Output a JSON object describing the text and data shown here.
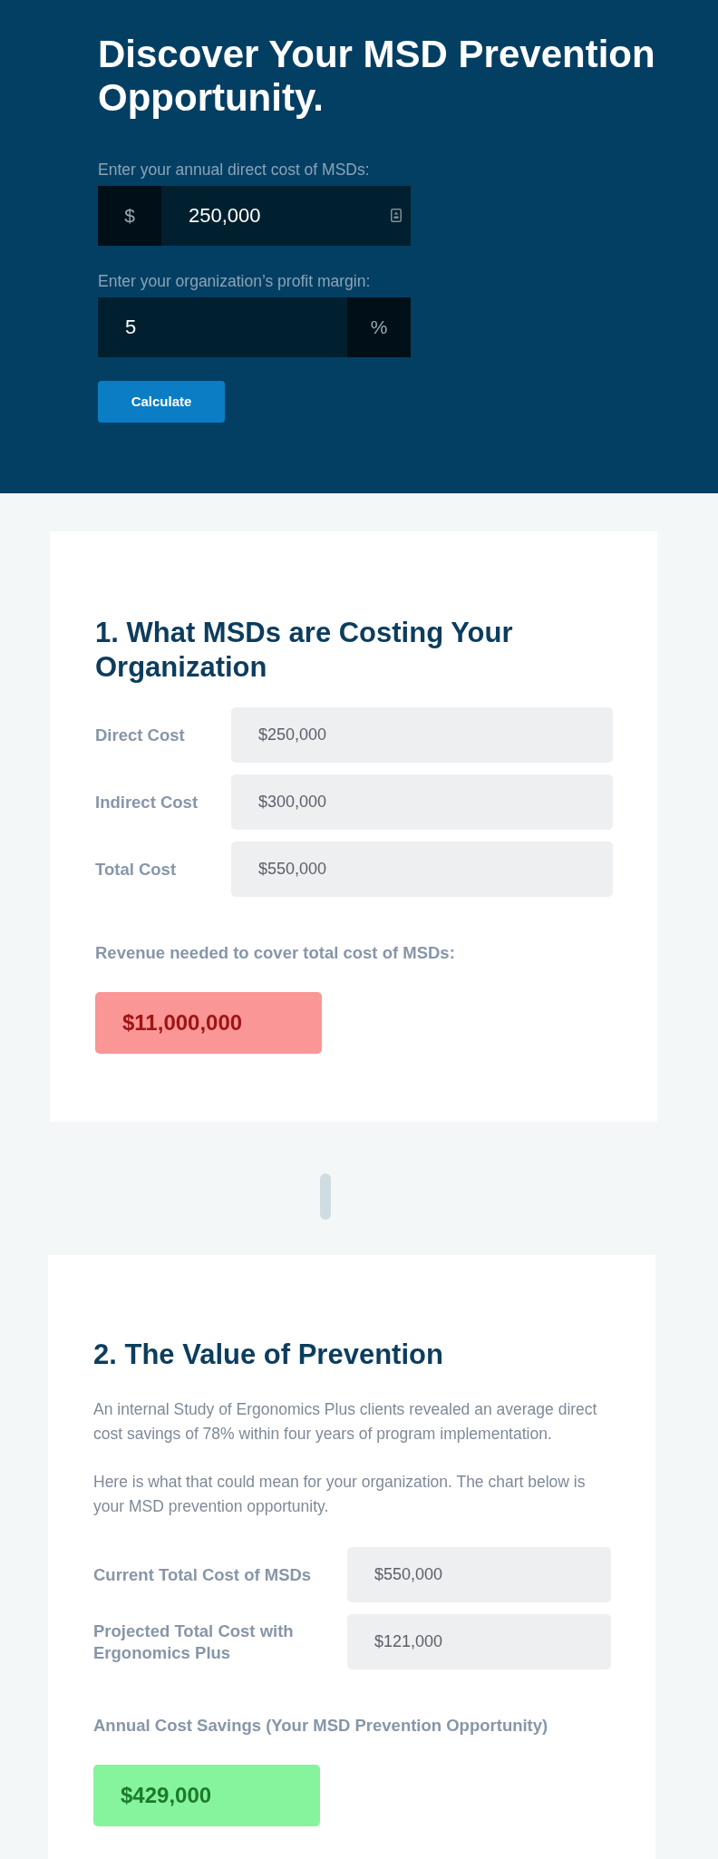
{
  "header": {
    "title": "Discover Your MSD Prevention Opportunity.",
    "fields": [
      {
        "kind": "prefix",
        "label": "Enter your annual direct cost of MSDs:",
        "addon": "$",
        "value": "250,000",
        "stepper": true
      },
      {
        "kind": "suffix",
        "label": "Enter your organization’s profit margin:",
        "addon": "%",
        "value": "5",
        "stepper": false
      }
    ],
    "button": "Calculate"
  },
  "sections": [
    {
      "heading": "1. What MSDs are Costing Your Organization",
      "rows": [
        {
          "label": "Direct Cost",
          "value": "$250,000"
        },
        {
          "label": "Indirect Cost",
          "value": "$300,000"
        },
        {
          "label": "Total Cost",
          "value": "$550,000"
        }
      ],
      "result": {
        "kind": "cost",
        "label": "Revenue needed to cover total cost of MSDs:",
        "value": "$11,000,000"
      }
    },
    {
      "heading": "2. The Value of Prevention",
      "paragraphs": [
        "An internal Study of Ergonomics Plus clients revealed an average direct cost savings of 78% within four years of program implementation.",
        "Here is what that could mean for your organization. The chart below is your MSD prevention opportunity."
      ],
      "rows": [
        {
          "label": "Current Total Cost of MSDs",
          "value": "$550,000"
        },
        {
          "label": "Projected Total Cost with Ergonomics Plus",
          "value": "$121,000"
        }
      ],
      "result": {
        "kind": "savings",
        "label": "Annual Cost Savings (Your MSD Prevention Opportunity)",
        "value": "$429,000"
      }
    }
  ]
}
